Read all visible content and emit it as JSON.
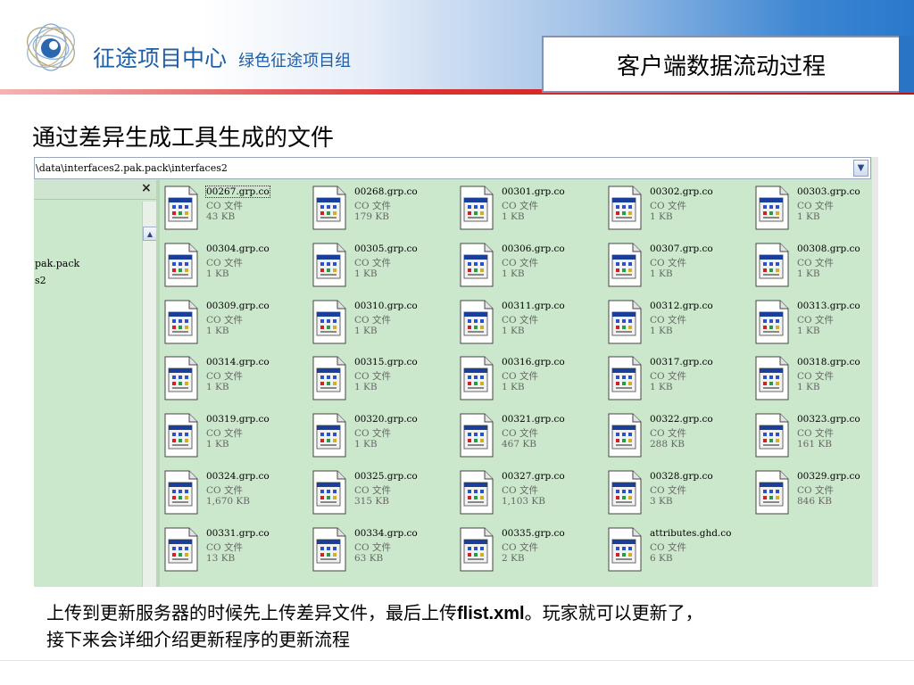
{
  "header": {
    "brand_main": "征途项目中心",
    "brand_sub": "绿色征途项目组",
    "slide_title": "客户端数据流动过程"
  },
  "subtitle": "通过差异生成工具生成的文件",
  "explorer": {
    "address": "\\data\\interfaces2.pak.pack\\interfaces2",
    "tree": {
      "close_glyph": "×",
      "items": [
        "pak.pack",
        "s2"
      ]
    },
    "file_type": "CO 文件",
    "files": [
      {
        "name": "00267.grp.co",
        "size": "43 KB"
      },
      {
        "name": "00268.grp.co",
        "size": "179 KB"
      },
      {
        "name": "00301.grp.co",
        "size": "1 KB"
      },
      {
        "name": "00302.grp.co",
        "size": "1 KB"
      },
      {
        "name": "00303.grp.co",
        "size": "1 KB"
      },
      {
        "name": "00304.grp.co",
        "size": "1 KB"
      },
      {
        "name": "00305.grp.co",
        "size": "1 KB"
      },
      {
        "name": "00306.grp.co",
        "size": "1 KB"
      },
      {
        "name": "00307.grp.co",
        "size": "1 KB"
      },
      {
        "name": "00308.grp.co",
        "size": "1 KB"
      },
      {
        "name": "00309.grp.co",
        "size": "1 KB"
      },
      {
        "name": "00310.grp.co",
        "size": "1 KB"
      },
      {
        "name": "00311.grp.co",
        "size": "1 KB"
      },
      {
        "name": "00312.grp.co",
        "size": "1 KB"
      },
      {
        "name": "00313.grp.co",
        "size": "1 KB"
      },
      {
        "name": "00314.grp.co",
        "size": "1 KB"
      },
      {
        "name": "00315.grp.co",
        "size": "1 KB"
      },
      {
        "name": "00316.grp.co",
        "size": "1 KB"
      },
      {
        "name": "00317.grp.co",
        "size": "1 KB"
      },
      {
        "name": "00318.grp.co",
        "size": "1 KB"
      },
      {
        "name": "00319.grp.co",
        "size": "1 KB"
      },
      {
        "name": "00320.grp.co",
        "size": "1 KB"
      },
      {
        "name": "00321.grp.co",
        "size": "467 KB"
      },
      {
        "name": "00322.grp.co",
        "size": "288 KB"
      },
      {
        "name": "00323.grp.co",
        "size": "161 KB"
      },
      {
        "name": "00324.grp.co",
        "size": "1,670 KB"
      },
      {
        "name": "00325.grp.co",
        "size": "315 KB"
      },
      {
        "name": "00327.grp.co",
        "size": "1,103 KB"
      },
      {
        "name": "00328.grp.co",
        "size": "3 KB"
      },
      {
        "name": "00329.grp.co",
        "size": "846 KB"
      },
      {
        "name": "00331.grp.co",
        "size": "13 KB"
      },
      {
        "name": "00334.grp.co",
        "size": "63 KB"
      },
      {
        "name": "00335.grp.co",
        "size": "2 KB"
      },
      {
        "name": "attributes.ghd.co",
        "size": "6 KB"
      }
    ]
  },
  "caption": {
    "line1_a": "上传到更新服务器的时候先上传差异文件，最后上传",
    "line1_bold": "flist.xml",
    "line1_b": "。玩家就可以更新了，",
    "line2": "接下来会详细介绍更新程序的更新流程"
  },
  "colors": {
    "brand_blue": "#1e5ea6",
    "explorer_bg": "#cce8cc",
    "accent_red": "#c01010"
  }
}
